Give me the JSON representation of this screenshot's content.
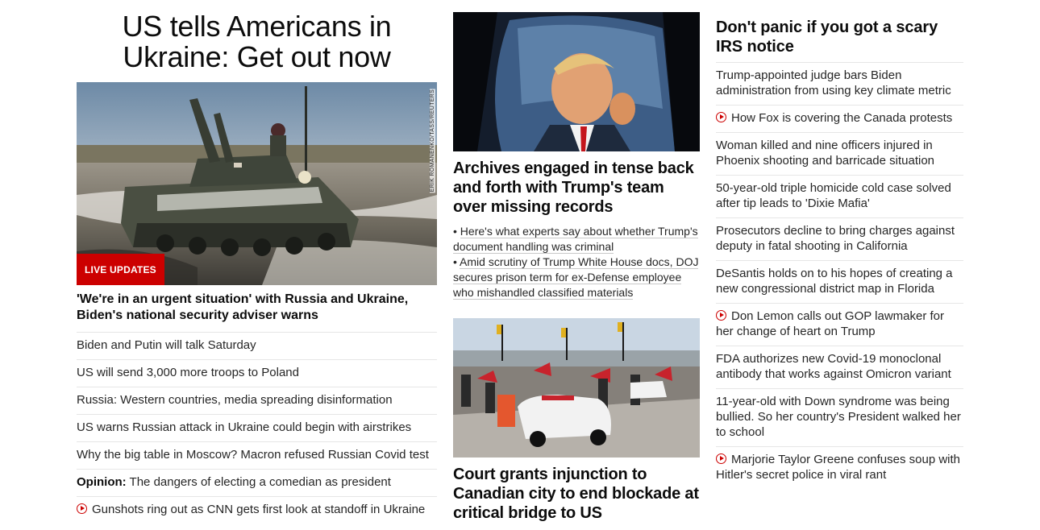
{
  "col1": {
    "headline": "US tells Americans in Ukraine: Get out now",
    "photo_credit": "ERIK ROMANENKO/TASS/REUTERS",
    "live_badge": "LIVE UPDATES",
    "lede": "'We're in an urgent situation' with Russia and Ukraine, Biden's national security adviser warns",
    "items": [
      {
        "text": "Biden and Putin will talk Saturday"
      },
      {
        "text": "US will send 3,000 more troops to Poland"
      },
      {
        "text": "Russia: Western countries, media spreading disinformation"
      },
      {
        "text": "US warns Russian attack in Ukraine could begin with airstrikes"
      },
      {
        "text": "Why the big table in Moscow? Macron refused Russian Covid test"
      },
      {
        "label": "Opinion:",
        "text": " The dangers of electing a comedian as president"
      },
      {
        "text": "Gunshots ring out as CNN gets first look at standoff in Ukraine",
        "icon": "play-video-icon"
      }
    ]
  },
  "col2": {
    "story1": {
      "headline": "Archives engaged in tense back and forth with Trump's team over missing records",
      "bullets": [
        "Here's what experts say about whether Trump's document handling was criminal",
        "Amid scrutiny of Trump White House docs, DOJ secures prison term for ex-Defense employee who mishandled classified materials"
      ]
    },
    "story2": {
      "headline": "Court grants injunction to Canadian city to end blockade at critical bridge to US"
    }
  },
  "col3": {
    "headline": "Don't panic if you got a scary IRS notice",
    "items": [
      {
        "text": "Trump-appointed judge bars Biden administration from using key climate metric"
      },
      {
        "text": "How Fox is covering the Canada protests",
        "icon": "play-video-icon"
      },
      {
        "text": "Woman killed and nine officers injured in Phoenix shooting and barricade situation"
      },
      {
        "text": "50-year-old triple homicide cold case solved after tip leads to 'Dixie Mafia'"
      },
      {
        "text": "Prosecutors decline to bring charges against deputy in fatal shooting in California"
      },
      {
        "text": "DeSantis holds on to his hopes of creating a new congressional district map in Florida"
      },
      {
        "text": "Don Lemon calls out GOP lawmaker for her change of heart on Trump",
        "icon": "play-video-icon"
      },
      {
        "text": "FDA authorizes new Covid-19 monoclonal antibody that works against Omicron variant"
      },
      {
        "text": "11-year-old with Down syndrome was being bullied. So her country's President walked her to school"
      },
      {
        "text": "Marjorie Taylor Greene confuses soup with Hitler's secret police in viral rant",
        "icon": "play-video-icon"
      }
    ]
  },
  "colors": {
    "accent": "#cc0000",
    "divider": "#e6e6e6",
    "text": "#262626"
  }
}
